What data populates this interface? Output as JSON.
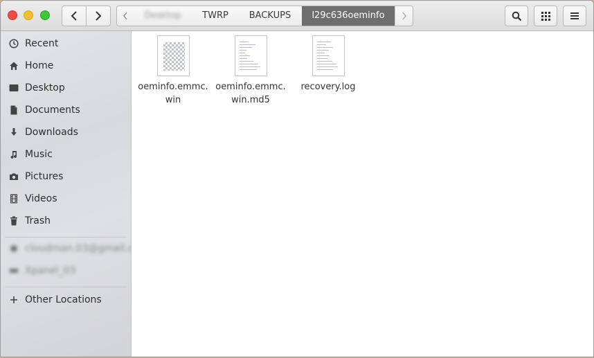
{
  "window_controls": {
    "close": "close",
    "minimize": "minimize",
    "maximize": "maximize"
  },
  "nav": {
    "back_icon": "chevron-left-icon",
    "forward_icon": "chevron-right-icon"
  },
  "pathbar": {
    "crumbs": [
      {
        "label": "Desktop",
        "blurred": true
      },
      {
        "label": "TWRP"
      },
      {
        "label": "BACKUPS"
      },
      {
        "label": "l29c636oeminfo",
        "active": true
      }
    ]
  },
  "toolbar": {
    "search_icon": "search-icon",
    "view_icon": "grid-icon",
    "menu_icon": "hamburger-menu-icon"
  },
  "sidebar": {
    "items": [
      {
        "label": "Recent",
        "icon": "clock-icon"
      },
      {
        "label": "Home",
        "icon": "home-icon"
      },
      {
        "label": "Desktop",
        "icon": "folder-icon"
      },
      {
        "label": "Documents",
        "icon": "document-icon"
      },
      {
        "label": "Downloads",
        "icon": "download-icon"
      },
      {
        "label": "Music",
        "icon": "music-icon"
      },
      {
        "label": "Pictures",
        "icon": "camera-icon"
      },
      {
        "label": "Videos",
        "icon": "film-icon"
      },
      {
        "label": "Trash",
        "icon": "trash-icon"
      }
    ],
    "accounts": [
      {
        "label": "cloudman.03@gmail.c...",
        "blurred": true
      },
      {
        "label": "Xpanel_03",
        "blurred": true
      }
    ],
    "other": {
      "label": "Other Locations",
      "icon": "plus-icon"
    }
  },
  "files": [
    {
      "name_line1": "oeminfo.emmc.",
      "name_line2": "win",
      "type": "image"
    },
    {
      "name_line1": "oeminfo.emmc.",
      "name_line2": "win.md5",
      "type": "text"
    },
    {
      "name_line1": "recovery.log",
      "name_line2": "",
      "type": "text"
    }
  ]
}
